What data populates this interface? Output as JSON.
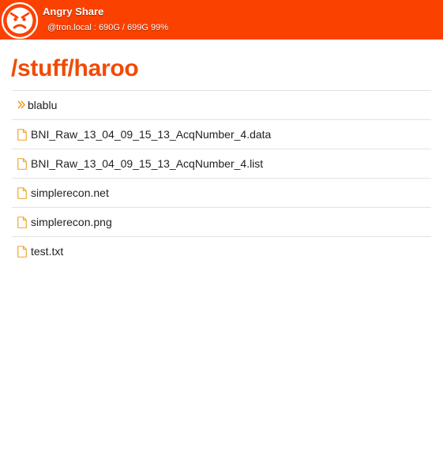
{
  "header": {
    "app_name": "Angry Share",
    "host_info": "@tron.local : 690G / 699G 99%",
    "logo_icon": "angry-face-icon",
    "accent_color": "#fb4100"
  },
  "main": {
    "path_title": "/stuff/haroo",
    "title_color": "#f24a05",
    "entries": [
      {
        "name": "blablu",
        "type": "directory",
        "icon": "double-chevron-right-icon"
      },
      {
        "name": "BNI_Raw_13_04_09_15_13_AcqNumber_4.data",
        "type": "file",
        "icon": "file-icon"
      },
      {
        "name": "BNI_Raw_13_04_09_15_13_AcqNumber_4.list",
        "type": "file",
        "icon": "file-icon"
      },
      {
        "name": "simplerecon.net",
        "type": "file",
        "icon": "file-icon"
      },
      {
        "name": "simplerecon.png",
        "type": "file",
        "icon": "file-icon"
      },
      {
        "name": "test.txt",
        "type": "file",
        "icon": "file-icon"
      }
    ]
  }
}
